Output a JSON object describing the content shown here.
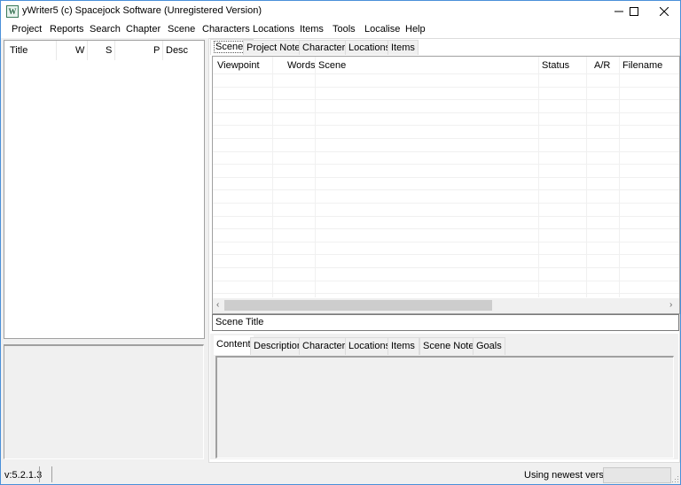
{
  "window": {
    "title": "yWriter5 (c) Spacejock Software (Unregistered Version)",
    "app_icon_glyph": "W"
  },
  "menu": [
    "Project",
    "Reports",
    "Search",
    "Chapter",
    "Scene",
    "Characters",
    "Locations",
    "Items",
    "Tools",
    "Localise",
    "Help"
  ],
  "chapter_list": {
    "columns": [
      "Title",
      "W",
      "S",
      "P",
      "Desc"
    ]
  },
  "top_tabs": [
    {
      "label": "Scenes",
      "active": true
    },
    {
      "label": "Project Notes",
      "active": false
    },
    {
      "label": "Characters",
      "active": false
    },
    {
      "label": "Locations",
      "active": false
    },
    {
      "label": "Items",
      "active": false
    }
  ],
  "scenes_grid": {
    "columns": [
      "Viewpoint",
      "Words",
      "Scene",
      "Status",
      "A/R",
      "Filename"
    ],
    "rows": []
  },
  "scene_title": {
    "value": "Scene Title"
  },
  "lower_tabs": [
    {
      "label": "Content",
      "active": true
    },
    {
      "label": "Description",
      "active": false
    },
    {
      "label": "Characters",
      "active": false
    },
    {
      "label": "Locations",
      "active": false
    },
    {
      "label": "Items",
      "active": false
    },
    {
      "label": "Scene Notes",
      "active": false
    },
    {
      "label": "Goals",
      "active": false
    }
  ],
  "status": {
    "version": "v:5.2.1.3",
    "update_message": "Using newest version"
  }
}
